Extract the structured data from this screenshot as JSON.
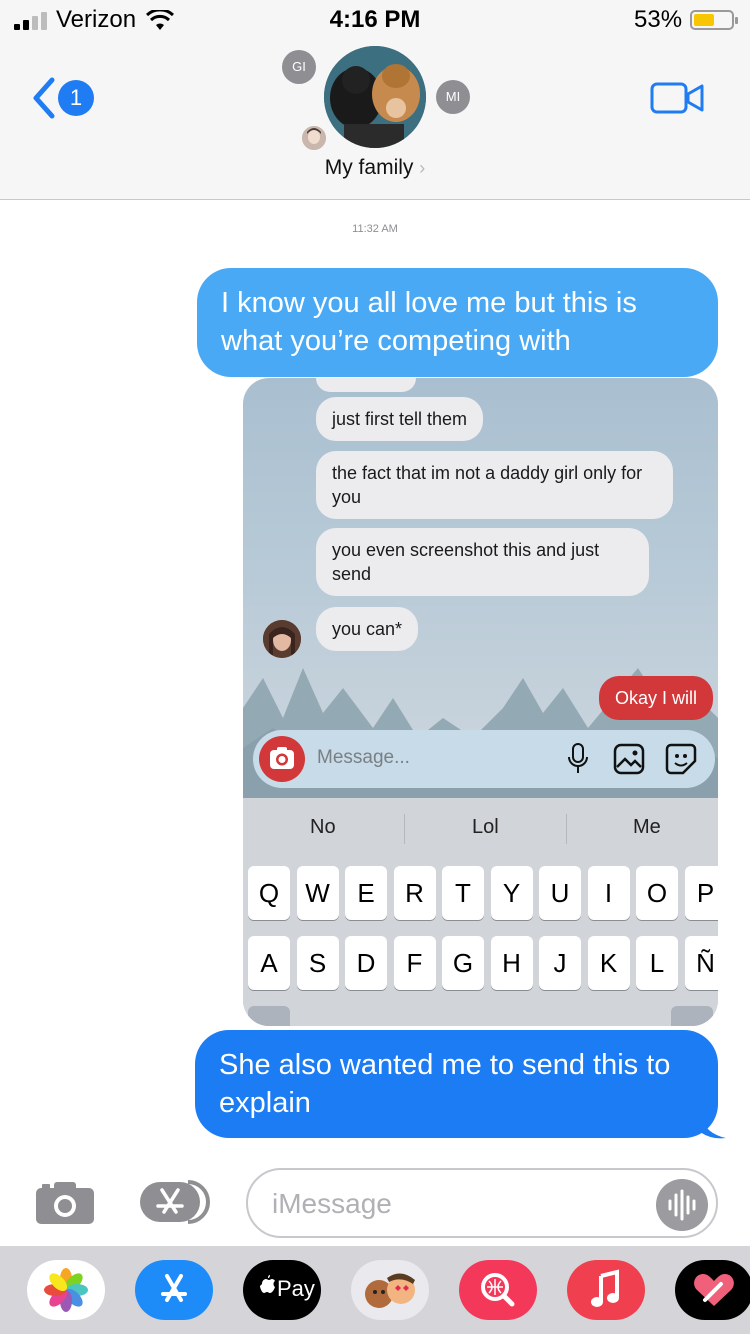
{
  "status_bar": {
    "carrier": "Verizon",
    "time": "4:16 PM",
    "battery_percent": "53%",
    "battery_level": 0.53
  },
  "header": {
    "back_badge": "1",
    "group_name": "My family",
    "members": [
      "GI",
      "MI"
    ]
  },
  "conversation": {
    "timestamp": "11:32 AM",
    "messages": [
      {
        "text": "I know you all love me but this is what you’re competing with",
        "from": "me"
      },
      {
        "text": "She also wanted me to send this to explain",
        "from": "me"
      }
    ],
    "attachment": {
      "bubbles": [
        {
          "text": "just first tell them",
          "from": "them"
        },
        {
          "text": "the fact that im not a daddy girl only for you",
          "from": "them"
        },
        {
          "text": "you even screenshot this and just send",
          "from": "them"
        },
        {
          "text": "you can*",
          "from": "them"
        },
        {
          "text": "Okay I will",
          "from": "me"
        }
      ],
      "message_placeholder": "Message...",
      "suggestions": [
        "No",
        "Lol",
        "Me"
      ],
      "keyboard_row1": [
        "Q",
        "W",
        "E",
        "R",
        "T",
        "Y",
        "U",
        "I",
        "O",
        "P"
      ],
      "keyboard_row2": [
        "A",
        "S",
        "D",
        "F",
        "G",
        "H",
        "J",
        "K",
        "L",
        "Ñ"
      ]
    }
  },
  "input_bar": {
    "placeholder": "iMessage"
  },
  "app_drawer": {
    "apps": [
      "photos-app-icon",
      "app-store-icon",
      "apple-pay-icon",
      "memoji-icon",
      "search-images-icon",
      "music-icon",
      "digital-touch-icon"
    ],
    "apple_pay_label": "Pay"
  },
  "colors": {
    "imessage_blue": "#1b7cf4",
    "light_blue": "#4aa9f4",
    "red_bubble": "#d2373a"
  }
}
